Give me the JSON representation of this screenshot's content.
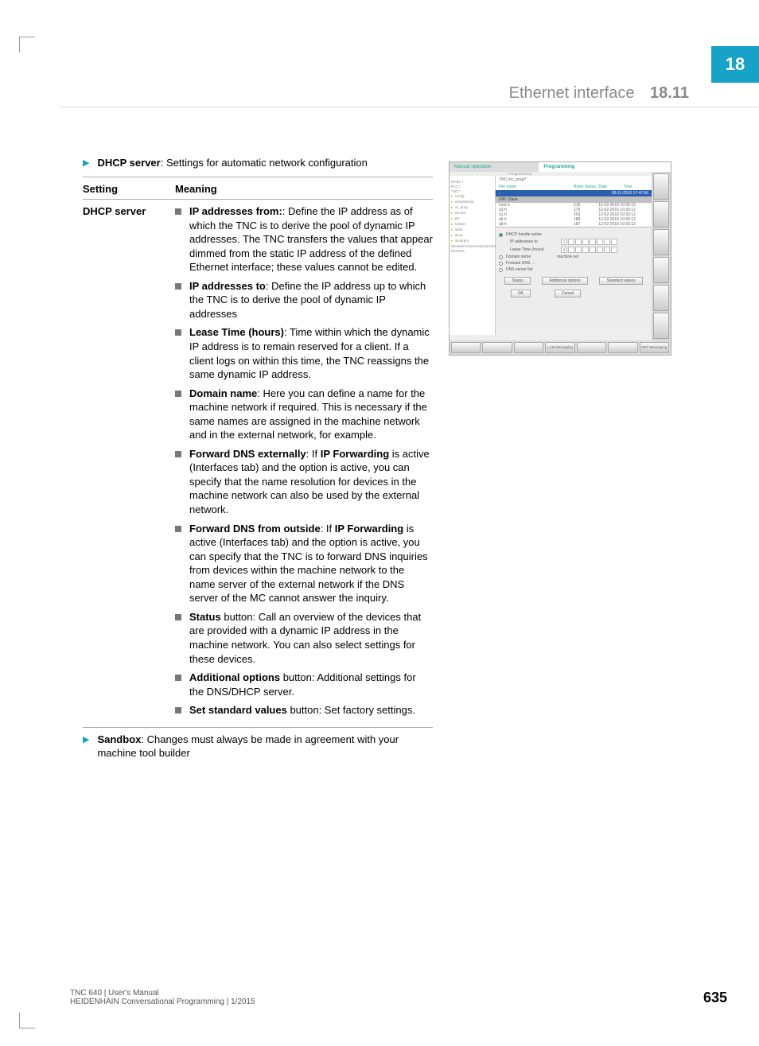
{
  "chapter_tab": "18",
  "section_title": "Ethernet interface",
  "section_number": "18.11",
  "intro": {
    "label": "DHCP server",
    "text": ": Settings for automatic network configuration"
  },
  "table": {
    "head": {
      "c1": "Setting",
      "c2": "Meaning"
    },
    "row_label": "DHCP server",
    "items": [
      {
        "bold": "IP addresses from:",
        "text": ": Define the IP address as of which the TNC is to derive the pool of dynamic IP addresses. The TNC transfers the values that appear dimmed from the static IP address of the defined Ethernet interface; these values cannot be edited."
      },
      {
        "bold": "IP addresses to",
        "text": ": Define the IP address up to which the TNC is to derive the pool of dynamic IP addresses"
      },
      {
        "bold": "Lease Time (hours)",
        "text": ": Time within which the dynamic IP address is to remain reserved for a client. If a client logs on within this time, the TNC reassigns the same dynamic IP address."
      },
      {
        "bold": "Domain name",
        "text": ": Here you can define a name for the machine network if required. This is necessary if the same names are assigned in the machine network and in the external network, for example."
      },
      {
        "bold": "Forward DNS externally",
        "mid": ": If ",
        "bold2": "IP Forwarding",
        "text": " is active (Interfaces tab) and the option is active, you can specify that the name resolution for devices in the machine network can also be used by the external network."
      },
      {
        "bold": "Forward DNS from outside",
        "mid": ": If ",
        "bold2": "IP Forwarding",
        "text": " is active (Interfaces tab) and the option is active, you can specify that the TNC is to forward DNS inquiries from devices within the machine network to the name server of the external network if the DNS server of the MC cannot answer the inquiry."
      },
      {
        "bold": "Status",
        "text": " button: Call an overview of the devices that are provided with a dynamic IP address in the machine network. You can also select settings for these devices."
      },
      {
        "bold": "Additional options",
        "text": " button: Additional settings for the DNS/DHCP server."
      },
      {
        "bold": "Set standard values",
        "text": " button: Set factory settings."
      }
    ]
  },
  "outro": {
    "label": "Sandbox",
    "text": ": Changes must always be made in agreement with your machine tool builder"
  },
  "footer": {
    "line1": "TNC 640 | User's Manual",
    "line2": "HEIDENHAIN Conversational Programming | 1/2015"
  },
  "page_number": "635",
  "fig": {
    "mode_left": "Manual operation",
    "mode_right": "Programming",
    "sub": "> Programming",
    "path": "TNC:\\nc_prog\\*",
    "filehead": {
      "a": "File name",
      "b": "Bytes Status",
      "c": "Date",
      "d": "Time"
    },
    "bluerow_l": "..",
    "bluerow_r": "09-11-2016  17:47:56",
    "greyhead_l": "DIR::1face",
    "files": [
      {
        "n": "host.h",
        "b": "216",
        "d": "12-02-2016 10:30:12"
      },
      {
        "n": "q3.h",
        "b": "175",
        "d": "12-02-2016 10:30:12"
      },
      {
        "n": "q1.h",
        "b": "203",
        "d": "12-02-2016 10:30:12"
      },
      {
        "n": "q6.h",
        "b": "188",
        "d": "12-02-2016 10:30:12"
      },
      {
        "n": "q8.h",
        "b": "187",
        "d": "12-02-2016 10:30:12"
      }
    ],
    "tree": [
      "MAIN: \\",
      "PLC:\\",
      "TNC:\\",
      " config",
      " smartNCbat",
      " nc_prog",
      " service",
      " pst",
      " system",
      " table",
      " temp",
      " tmcprgm",
      "\\Mounts\\Volumes\\Ncdir\\usbN..",
      "WORLD"
    ],
    "radios": [
      "DHCP handle active",
      "IP addresses to",
      "Lease Time (hours)",
      "Domain name",
      "Forward DNS …",
      "DNS server list"
    ],
    "domain_val": "machine.net",
    "btn_ok": "OK",
    "btn_cancel": "Cancel",
    "btn_standard": "Standard values",
    "btn_addopt": "Additional options",
    "btn_status": "Status",
    "soft": [
      "",
      "",
      "",
      "LAN Messaging",
      "",
      "",
      "NET Messaging"
    ]
  }
}
